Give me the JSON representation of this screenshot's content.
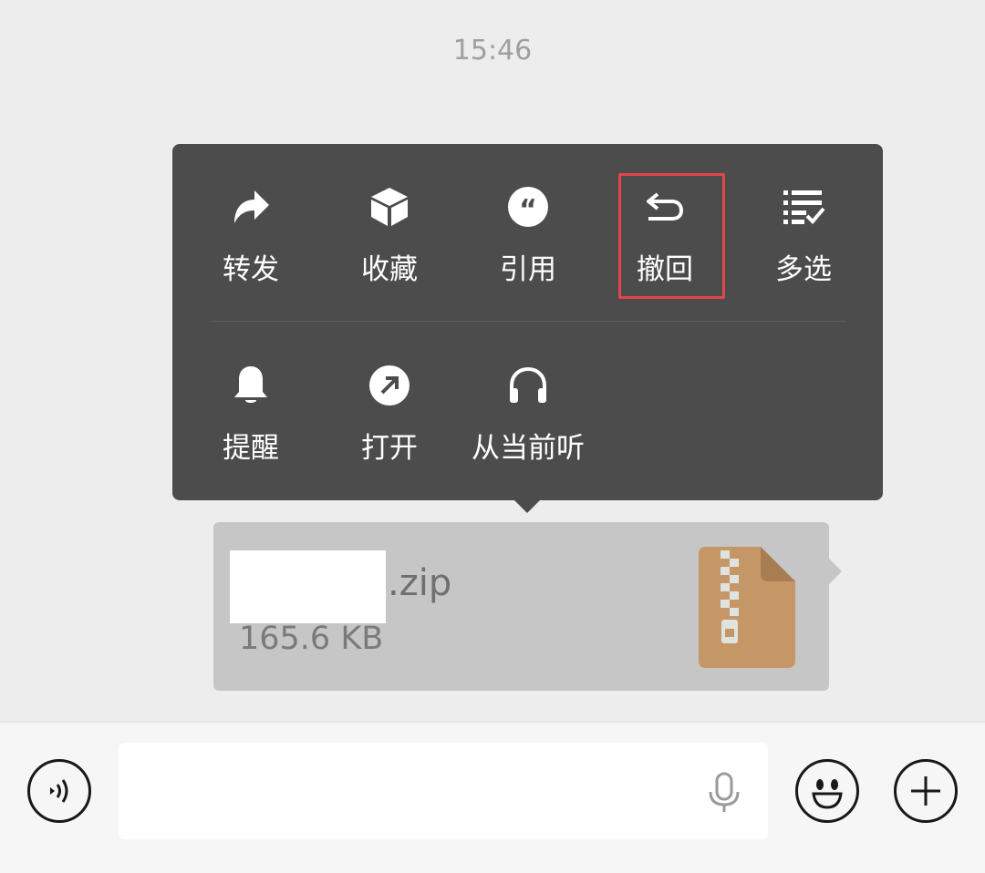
{
  "chat": {
    "timestamp": "15:46"
  },
  "context_menu": {
    "row1": [
      {
        "label": "转发",
        "icon": "forward-icon"
      },
      {
        "label": "收藏",
        "icon": "favorite-cube-icon"
      },
      {
        "label": "引用",
        "icon": "quote-icon"
      },
      {
        "label": "撤回",
        "icon": "recall-icon",
        "highlighted": true
      },
      {
        "label": "多选",
        "icon": "multi-select-icon"
      }
    ],
    "row2": [
      {
        "label": "提醒",
        "icon": "bell-icon"
      },
      {
        "label": "打开",
        "icon": "open-arrow-icon"
      },
      {
        "label": "从当前听",
        "icon": "headphones-icon"
      }
    ],
    "highlight_color": "#e0464c"
  },
  "file_message": {
    "extension": ".zip",
    "size": "165.6 KB",
    "icon": "zip-file-icon",
    "icon_color": "#c69766"
  },
  "input_bar": {
    "message_value": "",
    "voice_toggle_icon": "voice-mode-icon",
    "mic_icon": "microphone-icon",
    "emoji_icon": "emoji-icon",
    "more_icon": "plus-circle-icon"
  }
}
